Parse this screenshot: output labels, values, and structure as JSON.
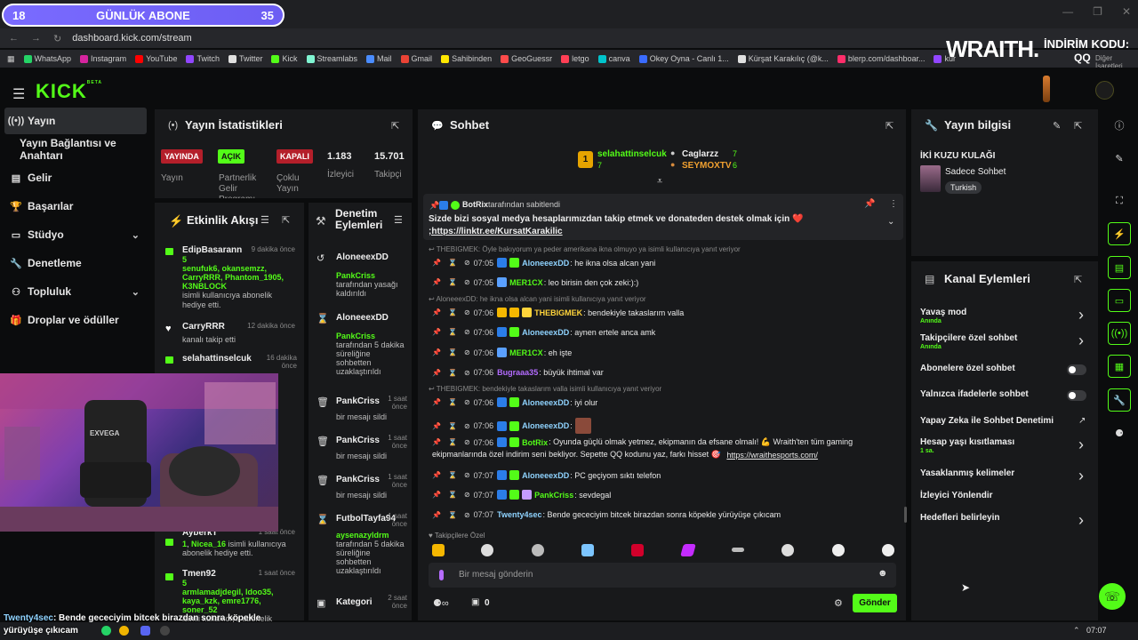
{
  "overlay": {
    "sub_goal": {
      "count": "18",
      "label": "GÜNLÜK ABONE",
      "target": "35"
    },
    "wraith": {
      "logo": "WRAITH.",
      "discount_label": "İNDİRİM KODU:",
      "code": "QQ",
      "bookmarks_tail": "Diğer İşaretleri"
    },
    "caption_user": "Twenty4sec",
    "caption_text": ": Bende gececiyim bitcek birazdan sonra köpekle yürüyüşe çıkıcam",
    "cam_brand": "EXVEGA"
  },
  "browser": {
    "url": "dashboard.kick.com/stream",
    "bookmarks": [
      {
        "label": "WhatsApp",
        "color": "#25d366"
      },
      {
        "label": "Instagram",
        "color": "#d6249f"
      },
      {
        "label": "YouTube",
        "color": "#ff0000"
      },
      {
        "label": "Twitch",
        "color": "#9146ff"
      },
      {
        "label": "Twitter",
        "color": "#e0e0e0"
      },
      {
        "label": "Kick",
        "color": "#53fc18"
      },
      {
        "label": "Streamlabs",
        "color": "#80f5d2"
      },
      {
        "label": "Mail",
        "color": "#4a8cff"
      },
      {
        "label": "Gmail",
        "color": "#ea4335"
      },
      {
        "label": "Sahibinden",
        "color": "#ffe800"
      },
      {
        "label": "GeoGuessr",
        "color": "#ff4b4b"
      },
      {
        "label": "letgo",
        "color": "#ff3f55"
      },
      {
        "label": "canva",
        "color": "#00c4cc"
      },
      {
        "label": "Okey Oyna - Canlı 1...",
        "color": "#3a6bff"
      },
      {
        "label": "Kürşat Karakılıç (@k...",
        "color": "#e0e0e0"
      },
      {
        "label": "blerp.com/dashboar...",
        "color": "#ff2d6a"
      },
      {
        "label": "kur",
        "color": "#9146ff"
      }
    ],
    "time": "07:07"
  },
  "sidebar": {
    "items": [
      {
        "label": "Yayın",
        "icon": "broadcast-icon"
      },
      {
        "label": "Yayın Bağlantısı ve Anahtarı",
        "icon": "key-icon"
      },
      {
        "label": "Gelir",
        "icon": "chart-icon"
      },
      {
        "label": "Başarılar",
        "icon": "trophy-icon"
      },
      {
        "label": "Stüdyo",
        "icon": "studio-icon"
      },
      {
        "label": "Denetleme",
        "icon": "wrench-icon"
      },
      {
        "label": "Topluluk",
        "icon": "community-icon"
      },
      {
        "label": "Droplar ve ödüller",
        "icon": "gift-icon"
      }
    ]
  },
  "stats": {
    "title": "Yayın İstatistikleri",
    "live_badge": "YAYINDA",
    "live_label": "Yayın",
    "partner_badge": "AÇIK",
    "partner_label": "Partnerlik Gelir Programı",
    "multi_badge": "KAPALI",
    "multi_label": "Çoklu Yayın",
    "viewers": "1.183",
    "viewers_label": "İzleyici",
    "followers": "15.701",
    "followers_label": "Takipçi"
  },
  "activity": {
    "title": "Etkinlik Akışı",
    "items": [
      {
        "user": "EdipBasarann",
        "time": "9 dakika önce",
        "gift": "5",
        "names": "senufuk6, okansemzz, CarryRRR, Phantom_1905, K3NBLOCK",
        "desc": "isimli kullanıcıya abonelik hediye etti."
      },
      {
        "user": "CarryRRR",
        "time": "12 dakika önce",
        "desc": "kanalı takip etti"
      },
      {
        "user": "selahattinselcuk",
        "time": "16 dakika önce"
      },
      {
        "user": "AyberkT",
        "time": "1 saat önce",
        "gift": "1",
        "names": "Nicea_16",
        "desc": "isimli kullanıcıya abonelik hediye etti."
      },
      {
        "user": "Tmen92",
        "time": "1 saat önce",
        "gift": "5",
        "names": "armlamadjdegil, ldoo35, kaya_kzk, emre1776, soner_52",
        "desc": "isimli kullanıcıya abonelik hediye etti."
      }
    ]
  },
  "moderation": {
    "title": "Denetim Eylemleri",
    "items": [
      {
        "user": "AloneeexDD",
        "time": "",
        "by": "PankCriss",
        "desc": "tarafından yasağı kaldırıldı"
      },
      {
        "user": "AloneeexDD",
        "time": "",
        "by": "PankCriss",
        "desc": "tarafından 5 dakika süreliğine sohbetten uzaklaştırıldı"
      },
      {
        "user": "PankCriss",
        "time": "1 saat önce",
        "desc": "bir mesajı sildi"
      },
      {
        "user": "PankCriss",
        "time": "1 saat önce",
        "desc": "bir mesajı sildi"
      },
      {
        "user": "PankCriss",
        "time": "1 saat önce",
        "desc": "bir mesajı sildi"
      },
      {
        "user": "FutbolTayfa94",
        "time": "1 saat önce",
        "by": "aysenazyldrm",
        "desc": "tarafından 5 dakika süreliğine sohbetten uzaklaştırıldı"
      },
      {
        "user": "Kategori",
        "time": "2 saat önce"
      }
    ]
  },
  "chat": {
    "title": "Sohbet",
    "top_gifters": [
      {
        "name": "selahattinselcuk",
        "count": "7",
        "rank": "1"
      },
      {
        "name": "Caglarzz",
        "count": "7"
      },
      {
        "name": "SEYMOXTV",
        "count": "6"
      }
    ],
    "pinned": {
      "by": "BotRix",
      "by_suffix": "tarafından sabitlendi",
      "text": "Sizde bizi sosyal medya hesaplarımızdan takip etmek ve donateden destek olmak için ❤️",
      "link": ";https://linktr.ee/KursatKarakilic"
    },
    "messages": [
      {
        "reply": "THEBIGMEK: Öyle bakıyorum ya peder amerikana ikna olmuyo ya isimli kullanıcıya yanıt veriyor"
      },
      {
        "time": "07:05",
        "user": "AloneeexDD",
        "color": "#8fd3ff",
        "text": ": he ikna olsa alcan yani"
      },
      {
        "time": "07:05",
        "user": "MER1CX",
        "color": "#53fc18",
        "text": ": leo birisin den çok zeki:):)"
      },
      {
        "reply": "AloneeexDD: he ikna olsa alcan yani isimli kullanıcıya yanıt veriyor"
      },
      {
        "time": "07:06",
        "user": "THEBIGMEK",
        "color": "#ffd43b",
        "text": ": bendekiyle takaslarım valla"
      },
      {
        "time": "07:06",
        "user": "AloneeexDD",
        "color": "#8fd3ff",
        "text": ": aynen ertele anca amk"
      },
      {
        "time": "07:06",
        "user": "MER1CX",
        "color": "#53fc18",
        "text": ": eh işte"
      },
      {
        "time": "07:06",
        "user": "Bugraaa35",
        "color": "#b36bff",
        "text": ": büyük ihtimal var"
      },
      {
        "reply": "THEBIGMEK: bendekiyle takaslarım valla isimli kullanıcıya yanıt veriyor"
      },
      {
        "time": "07:06",
        "user": "AloneeexDD",
        "color": "#8fd3ff",
        "text": ": iyi olur"
      },
      {
        "time": "07:06",
        "user": "AloneeexDD",
        "color": "#8fd3ff",
        "text": ":"
      },
      {
        "time": "07:06",
        "user": "BotRix",
        "color": "#53fc18",
        "text": ": Oyunda güçlü olmak yetmez, ekipmanın da efsane olmalı! 💪 Wraith'ten tüm gaming",
        "text2": "ekipmanlarında özel indirim seni bekliyor. Sepette QQ kodunu yaz, farkı hisset 🎯",
        "link": "https://wraithesports.com/"
      },
      {
        "time": "07:07",
        "user": "AloneeexDD",
        "color": "#8fd3ff",
        "text": ": PC geçiyom sıktı telefon"
      },
      {
        "time": "07:07",
        "user": "PankCriss",
        "color": "#53fc18",
        "text": ": sevdegal"
      },
      {
        "time": "07:07",
        "user": "Twenty4sec",
        "color": "#8fd3ff",
        "text": ": Bende gececiyim bitcek birazdan sonra köpekle yürüyüşe çıkıcam"
      }
    ],
    "followers_only": "Takipçilere Özel",
    "input_placeholder": "Bir mesaj gönderin",
    "points": "0",
    "send": "Gönder"
  },
  "stream_info": {
    "title": "Yayın bilgisi",
    "stream_title": "İKİ KUZU KULAĞI",
    "category": "Sadece Sohbet",
    "tag": "Turkish"
  },
  "channel_actions": {
    "title": "Kanal Eylemleri",
    "items": [
      {
        "label": "Yavaş mod",
        "sub": "Anında",
        "type": "chevron"
      },
      {
        "label": "Takipçilere özel sohbet",
        "sub": "Anında",
        "type": "chevron"
      },
      {
        "label": "Abonelere özel sohbet",
        "type": "toggle"
      },
      {
        "label": "Yalnızca ifadelerle sohbet",
        "type": "toggle"
      },
      {
        "label": "Yapay Zeka ile Sohbet Denetimi",
        "type": "external"
      },
      {
        "label": "Hesap yaşı kısıtlaması",
        "sub": "1 sa.",
        "type": "chevron"
      },
      {
        "label": "Yasaklanmış kelimeler",
        "type": "chevron"
      },
      {
        "label": "İzleyici Yönlendir",
        "type": "none"
      },
      {
        "label": "Hedefleri belirleyin",
        "type": "chevron"
      }
    ]
  }
}
